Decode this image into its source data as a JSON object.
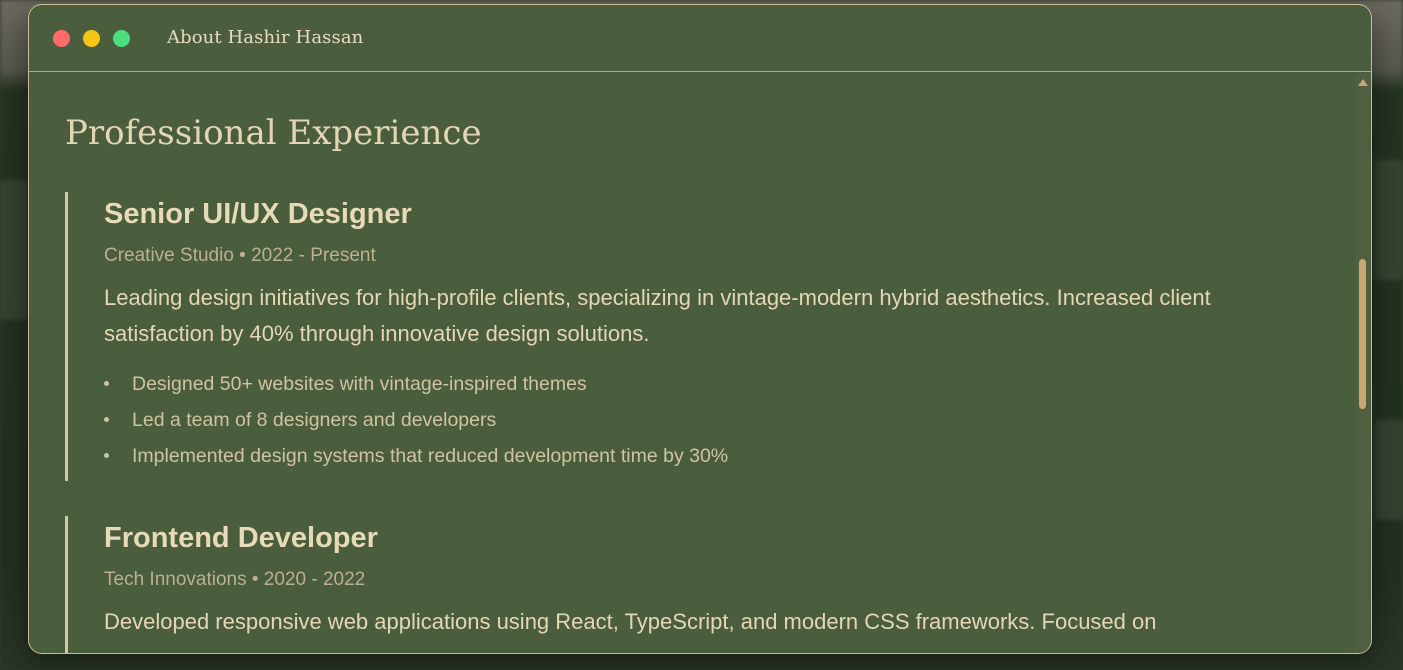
{
  "window": {
    "title": "About Hashir Hassan",
    "controls": [
      "close",
      "minimize",
      "maximize"
    ]
  },
  "section": {
    "title": "Professional Experience"
  },
  "jobs": [
    {
      "title": "Senior UI/UX Designer",
      "meta": "Creative Studio • 2022 - Present",
      "description": "Leading design initiatives for high-profile clients, specializing in vintage-modern hybrid aesthetics. Increased client satisfaction by 40% through innovative design solutions.",
      "bullets": [
        "Designed 50+ websites with vintage-inspired themes",
        "Led a team of 8 designers and developers",
        "Implemented design systems that reduced development time by 30%"
      ]
    },
    {
      "title": "Frontend Developer",
      "meta": "Tech Innovations • 2020 - 2022",
      "description": "Developed responsive web applications using React, TypeScript, and modern CSS frameworks. Focused on"
    }
  ],
  "colors": {
    "window_bg": "#4a5d3c",
    "accent": "#c9a774",
    "text": "#e6dab9",
    "close": "#ff6b6b",
    "minimize": "#f5c518",
    "maximize": "#4ade80"
  }
}
